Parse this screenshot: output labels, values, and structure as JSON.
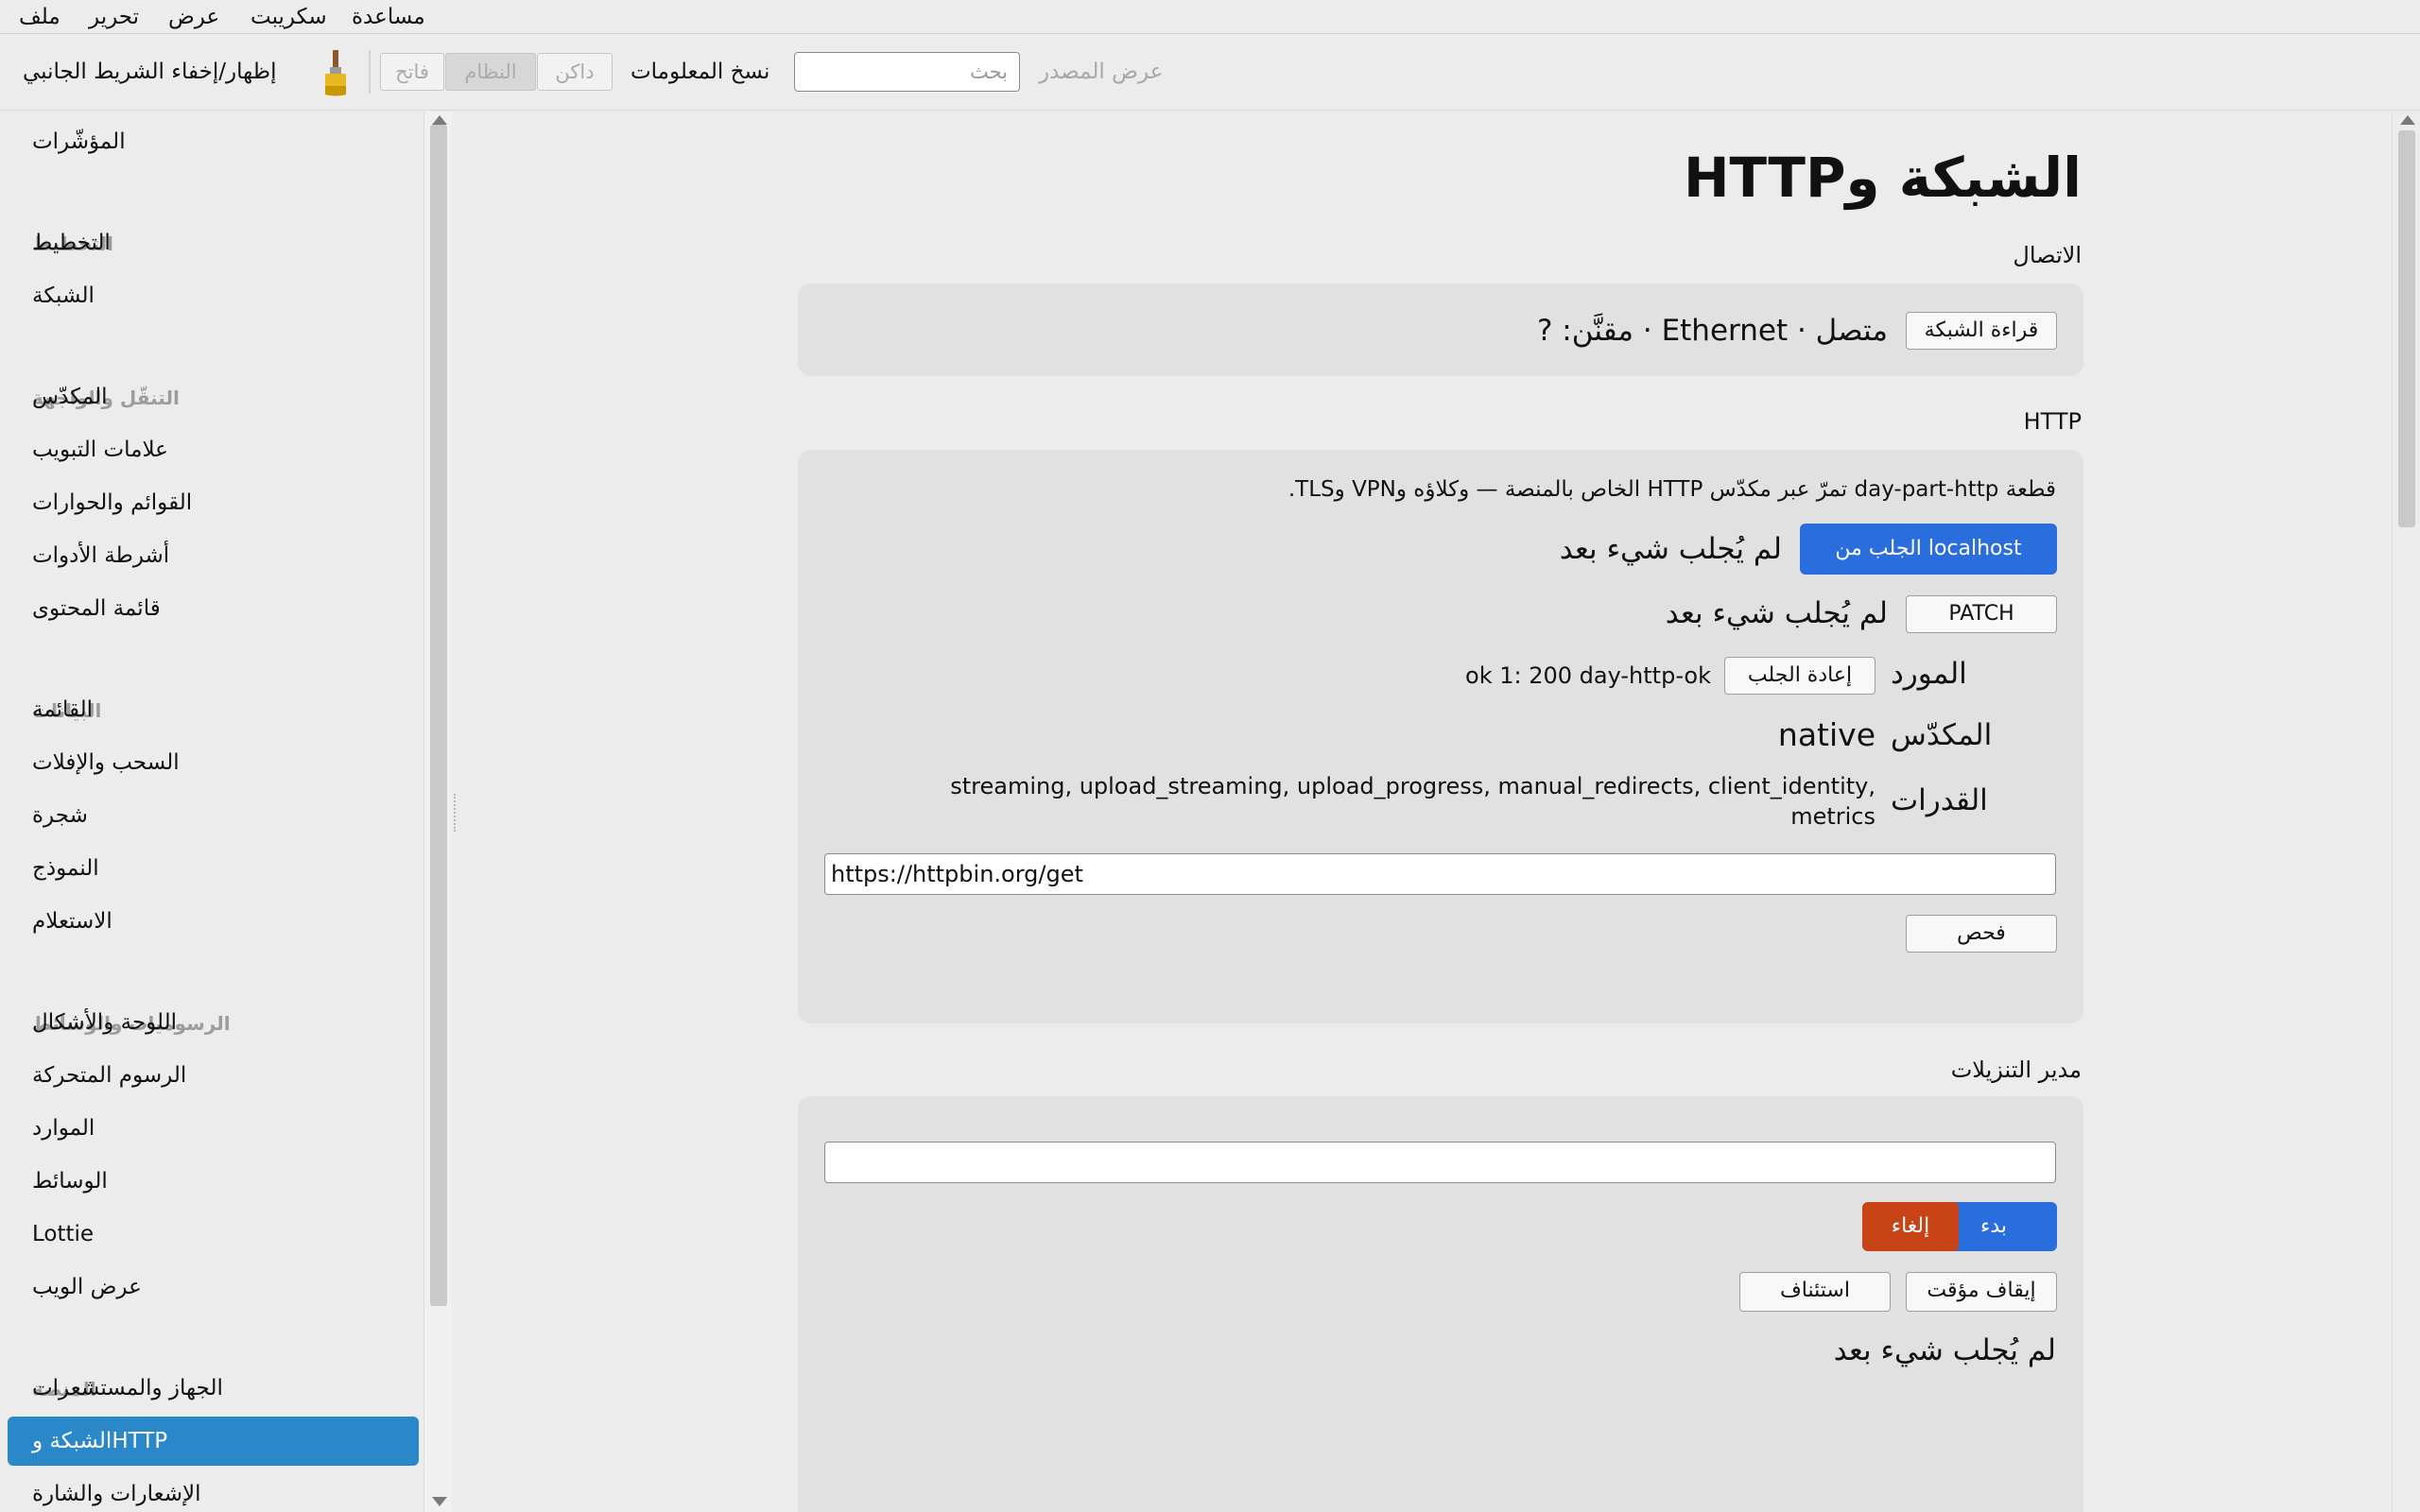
{
  "menu": {
    "file": "ملف",
    "edit": "تحرير",
    "view": "عرض",
    "script": "سكريبت",
    "help": "مساعدة"
  },
  "toolbar": {
    "toggle_sidebar": "إظهار/إخفاء الشريط الجانبي",
    "brush_icon": "paintbrush-icon",
    "theme_light": "فاتح",
    "theme_system": "النظام",
    "theme_dark": "داكن",
    "copy_info": "نسخ المعلومات",
    "search_placeholder": "بحث",
    "view_source": "عرض المصدر"
  },
  "sidebar": {
    "items": [
      {
        "label": "المؤشّرات"
      },
      {
        "header": "التخطيط"
      },
      {
        "label": "التخطيط"
      },
      {
        "label": "الشبكة"
      },
      {
        "header": "التنقّل والواجهة"
      },
      {
        "label": "المكدّس"
      },
      {
        "label": "علامات التبويب"
      },
      {
        "label": "القوائم والحوارات"
      },
      {
        "label": "أشرطة الأدوات"
      },
      {
        "label": "قائمة المحتوى"
      },
      {
        "header": "البيانات"
      },
      {
        "label": "القائمة"
      },
      {
        "label": "السحب والإفلات"
      },
      {
        "label": "شجرة"
      },
      {
        "label": "النموذج"
      },
      {
        "label": "الاستعلام"
      },
      {
        "header": "الرسوميات والوسائط"
      },
      {
        "label": "اللوحة والأشكال"
      },
      {
        "label": "الرسوم المتحركة"
      },
      {
        "label": "الموارد"
      },
      {
        "label": "الوسائط"
      },
      {
        "label": "Lottie"
      },
      {
        "label": "عرض الويب"
      },
      {
        "header": "المنصة"
      },
      {
        "label": "الجهاز والمستشعرات"
      },
      {
        "label": "الشبكة وHTTP",
        "active": true
      },
      {
        "label": "الإشعارات والشارة"
      }
    ]
  },
  "page": {
    "title": "الشبكة وHTTP"
  },
  "connection": {
    "section_title": "الاتصال",
    "read_button": "قراءة الشبكة",
    "status": "متصل · Ethernet · مقنَّن: ?"
  },
  "http": {
    "section_title": "HTTP",
    "description": "قطعة day-part-http تمرّ عبر مكدّس HTTP الخاص بالمنصة — وكلاؤه وVPN وTLS.",
    "fetch_button": "الجلب من localhost",
    "fetch_status": "لم يُجلب شيء بعد",
    "patch_button": "PATCH",
    "patch_status": "لم يُجلب شيء بعد",
    "resource_label": "المورد",
    "refetch_button": "إعادة الجلب",
    "resource_value": "ok 1: 200 day-http-ok",
    "stack_label": "المكدّس",
    "stack_value": "native",
    "capabilities_label": "القدرات",
    "capabilities_line1": "streaming, upload_streaming, upload_progress, manual_redirects, client_identity,",
    "capabilities_line2": "metrics",
    "url_value": "https://httpbin.org/get",
    "check_button": "فحص"
  },
  "downloads": {
    "section_title": "مدير التنزيلات",
    "url_value": "",
    "start_button": "بدء",
    "cancel_button": "إلغاء",
    "pause_button": "إيقاف مؤقت",
    "resume_button": "استئناف",
    "status": "لم يُجلب شيء بعد"
  },
  "colors": {
    "accent": "#2a6ede",
    "selection": "#2a88c8",
    "danger": "#c84315"
  }
}
